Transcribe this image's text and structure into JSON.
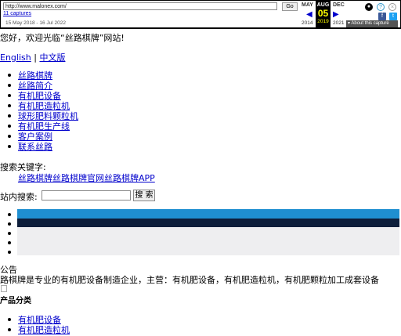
{
  "wayback": {
    "url": "http://www.malonex.com/",
    "go_label": "Go",
    "captures": "11 captures",
    "range": "15 May 2018 - 16 Jul 2022",
    "prev_month": "MAY",
    "cur_month": "AUG",
    "next_month": "DEC",
    "cur_day": "05",
    "prev_year": "2014",
    "cur_year": "2019",
    "next_year": "2021",
    "about": "About this capture"
  },
  "page": {
    "greeting": "您好，欢迎光临“丝路棋牌”网站!",
    "lang_en": "English",
    "lang_sep": "|",
    "lang_cn": "中文版",
    "nav": [
      "丝路棋牌",
      "丝路简介",
      "有机肥设备",
      "有机肥造粒机",
      "球形肥料颗粒机",
      "有机肥生产线",
      "客户案例",
      "联系丝路"
    ],
    "search_keywords_label": "搜索关键字:",
    "search_keywords": "丝路棋牌丝路棋牌官网丝路棋牌APP",
    "site_search_label": "站内搜索:",
    "search_button": "搜 索",
    "notice_title": "公告",
    "notice_text": "路棋牌是专业的有机肥设备制造企业，主营：有机肥设备，有机肥造粒机，有机肥颗粒加工成套设备",
    "products_title": "产品分类",
    "products": [
      "有机肥设备",
      "有机肥造粒机"
    ]
  },
  "colors": {
    "bar1": "#1f8fd1",
    "bar2": "#0d1e3b",
    "bar3": "#eeeef0"
  }
}
